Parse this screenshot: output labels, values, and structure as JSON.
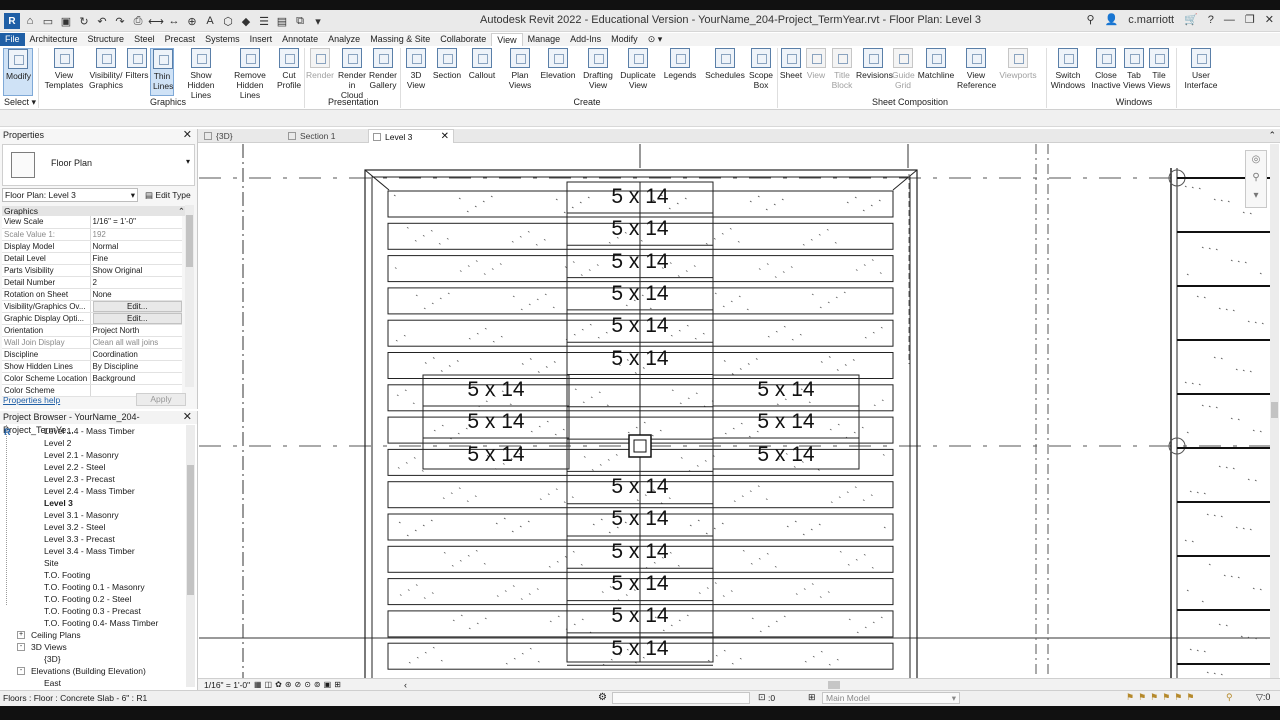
{
  "window": {
    "title": "Autodesk Revit 2022 - Educational Version - YourName_204-Project_TermYear.rvt - Floor Plan: Level 3",
    "user": "c.marriott"
  },
  "menu": {
    "tabs": [
      "File",
      "Architecture",
      "Structure",
      "Steel",
      "Precast",
      "Systems",
      "Insert",
      "Annotate",
      "Analyze",
      "Massing & Site",
      "Collaborate",
      "View",
      "Manage",
      "Add-Ins",
      "Modify"
    ],
    "active": "View"
  },
  "ribbon": {
    "modify": "Modify",
    "select": "Select",
    "buttons": {
      "view_templates": [
        "View",
        "Templates"
      ],
      "visibility_graphics": [
        "Visibility/",
        "Graphics"
      ],
      "filters": [
        "Filters"
      ],
      "thin_lines": [
        "Thin",
        "Lines"
      ],
      "show_hidden": [
        "Show",
        "Hidden Lines"
      ],
      "remove_hidden": [
        "Remove",
        "Hidden Lines"
      ],
      "cut_profile": [
        "Cut",
        "Profile"
      ],
      "render": [
        "Render"
      ],
      "render_cloud": [
        "Render",
        "in Cloud"
      ],
      "render_gallery": [
        "Render",
        "Gallery"
      ],
      "view_3d": [
        "3D",
        "View"
      ],
      "section": [
        "Section"
      ],
      "callout": [
        "Callout"
      ],
      "plan_views": [
        "Plan",
        "Views"
      ],
      "elevation": [
        "Elevation"
      ],
      "drafting_view": [
        "Drafting",
        "View"
      ],
      "duplicate_view": [
        "Duplicate",
        "View"
      ],
      "legends": [
        "Legends"
      ],
      "schedules": [
        "Schedules"
      ],
      "scope_box": [
        "Scope",
        "Box"
      ],
      "sheet": [
        "Sheet"
      ],
      "view": [
        "View"
      ],
      "title_block": [
        "Title",
        "Block"
      ],
      "revisions": [
        "Revisions"
      ],
      "guide_grid": [
        "Guide",
        "Grid"
      ],
      "matchline": [
        "Matchline"
      ],
      "view_reference": [
        "View",
        "Reference"
      ],
      "viewports": [
        "Viewports"
      ],
      "switch_windows": [
        "Switch",
        "Windows"
      ],
      "close_inactive": [
        "Close",
        "Inactive"
      ],
      "tab_views": [
        "Tab",
        "Views"
      ],
      "tile_views": [
        "Tile",
        "Views"
      ],
      "user_interface": [
        "User",
        "Interface"
      ]
    },
    "groups": {
      "graphics": "Graphics",
      "presentation": "Presentation",
      "create": "Create",
      "sheet_composition": "Sheet Composition",
      "windows": "Windows"
    }
  },
  "properties": {
    "title": "Properties",
    "type_name": "Floor Plan",
    "instance": "Floor Plan: Level 3",
    "edit_type": "Edit Type",
    "group": "Graphics",
    "rows": [
      {
        "k": "View Scale",
        "v": "1/16\" = 1'-0\""
      },
      {
        "k": "Scale Value    1:",
        "v": "192"
      },
      {
        "k": "Display Model",
        "v": "Normal"
      },
      {
        "k": "Detail Level",
        "v": "Fine"
      },
      {
        "k": "Parts Visibility",
        "v": "Show Original"
      },
      {
        "k": "Detail Number",
        "v": "2"
      },
      {
        "k": "Rotation on Sheet",
        "v": "None"
      },
      {
        "k": "Visibility/Graphics Ov...",
        "v": "Edit..."
      },
      {
        "k": "Graphic Display Opti...",
        "v": "Edit..."
      },
      {
        "k": "Orientation",
        "v": "Project North"
      },
      {
        "k": "Wall Join Display",
        "v": "Clean all wall joins"
      },
      {
        "k": "Discipline",
        "v": "Coordination"
      },
      {
        "k": "Show Hidden Lines",
        "v": "By Discipline"
      },
      {
        "k": "Color Scheme Location",
        "v": "Background"
      },
      {
        "k": "Color Scheme",
        "v": ""
      }
    ],
    "help": "Properties help",
    "apply": "Apply"
  },
  "browser": {
    "title": "Project Browser - YourName_204-Project_TermYe...",
    "items": [
      {
        "label": "Level 1.4 - Mass Timber",
        "indent": 44
      },
      {
        "label": "Level 2",
        "indent": 44
      },
      {
        "label": "Level 2.1 - Masonry",
        "indent": 44
      },
      {
        "label": "Level 2.2 - Steel",
        "indent": 44
      },
      {
        "label": "Level 2.3 - Precast",
        "indent": 44
      },
      {
        "label": "Level 2.4 - Mass Timber",
        "indent": 44
      },
      {
        "label": "Level 3",
        "indent": 44,
        "bold": true
      },
      {
        "label": "Level 3.1 - Masonry",
        "indent": 44
      },
      {
        "label": "Level 3.2 - Steel",
        "indent": 44
      },
      {
        "label": "Level 3.3 - Precast",
        "indent": 44
      },
      {
        "label": "Level 3.4 - Mass Timber",
        "indent": 44
      },
      {
        "label": "Site",
        "indent": 44
      },
      {
        "label": "T.O. Footing",
        "indent": 44
      },
      {
        "label": "T.O. Footing 0.1 - Masonry",
        "indent": 44
      },
      {
        "label": "T.O. Footing 0.2 - Steel",
        "indent": 44
      },
      {
        "label": "T.O. Footing 0.3 - Precast",
        "indent": 44
      },
      {
        "label": "T.O. Footing 0.4- Mass Timber",
        "indent": 44
      },
      {
        "label": "Ceiling Plans",
        "indent": 31,
        "toggle": "+"
      },
      {
        "label": "3D Views",
        "indent": 31,
        "toggle": "-"
      },
      {
        "label": "{3D}",
        "indent": 44
      },
      {
        "label": "Elevations (Building Elevation)",
        "indent": 31,
        "toggle": "-"
      },
      {
        "label": "East",
        "indent": 44
      }
    ]
  },
  "view_tabs": [
    {
      "label": "{3D}",
      "active": false
    },
    {
      "label": "Section 1",
      "active": false
    },
    {
      "label": "Level 3",
      "active": true
    }
  ],
  "tags": {
    "top": [
      "5 x 14",
      "5 x 14",
      "5 x 14",
      "5 x 14",
      "5 x 14",
      "5 x 14"
    ],
    "left": [
      "5 x 14",
      "5 x 14",
      "5 x 14"
    ],
    "right": [
      "5 x 14",
      "5 x 14",
      "5 x 14"
    ],
    "bottom": [
      "5 x 14",
      "5 x 14",
      "5 x 14",
      "5 x 14",
      "5 x 14",
      "5 x 14"
    ]
  },
  "view_control": {
    "scale": "1/16\" = 1'-0\""
  },
  "status": {
    "message": "Floors : Floor : Concrete Slab - 6\" : R1",
    "zero": ":0",
    "model": "Main Model"
  },
  "colors": {
    "accent": "#1f5fa6",
    "highlight": "#cfe2f6"
  }
}
